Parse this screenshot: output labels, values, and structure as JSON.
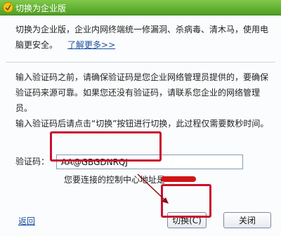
{
  "window": {
    "title": "切换为企业版"
  },
  "intro": {
    "text": "切换为企业版，企业内网终端统一修漏洞、杀病毒、清木马，使用电脑更安全。",
    "learn_more": "了解更多>>"
  },
  "notice": {
    "text": "输入验证码之前，请确保验证码是您企业网络管理员提供的，要确保验证码来源可靠。如果您还没有验证码，请联系您企业的网络管理员。",
    "text2": "输入验证码后请点击“切换”按钮进行切换，此过程仅需要数秒时间。"
  },
  "code": {
    "label": "验证码：",
    "value": "AA@GBGDNRQJ",
    "control_center_text": "您要连接的控制中心地址是"
  },
  "footer": {
    "back_label": "返回",
    "switch_label": "切换(C)",
    "close_label": "关闭"
  },
  "colors": {
    "titlebar": "#5faf2c",
    "highlight": "#c8102e",
    "link": "#1a4fa0"
  }
}
